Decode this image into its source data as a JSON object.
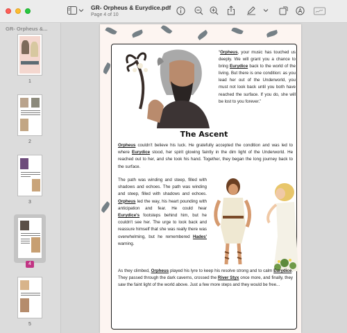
{
  "window": {
    "title": "GR- Orpheus & Eurydice.pdf",
    "subtitle": "Page 4 of 10"
  },
  "toolbar": {
    "icons": [
      "sidebar-toggle-icon",
      "chevron-down-icon",
      "info-icon",
      "zoom-out-icon",
      "zoom-in-icon",
      "share-icon",
      "markup-pen-icon",
      "chevron-down-icon",
      "rotate-icon",
      "annotate-icon",
      "sign-icon"
    ]
  },
  "sidebar": {
    "title": "GR- Orpheus &...",
    "thumbnails": [
      {
        "page": "1"
      },
      {
        "page": "2"
      },
      {
        "page": "3"
      },
      {
        "page": "4",
        "selected": true
      },
      {
        "page": "5"
      }
    ]
  },
  "page": {
    "quote": {
      "open": "“",
      "name1": "Orpheus",
      "t1": ", your music has touched us deeply. We will grant you a chance to bring ",
      "name2": "Eurydice",
      "t2": " back to the world of the living. But there is one condition: as you lead her out of the Underworld, you must not look back until you both have reached the surface. If you do, she will be lost to you forever.”"
    },
    "section_title": "The Ascent",
    "p1": {
      "name1": "Orpheus",
      "t1": " couldn't believe his luck. He gratefully accepted the condition and was led to where ",
      "name2": "Eurydice",
      "t2": " stood, her spirit glowing faintly in the dim light of the Underworld. He reached out to her, and she took his hand. Together, they began the long journey back to the surface."
    },
    "p2": {
      "t0": "The path was winding and steep, filled with shadows and echoes. The path was winding and steep, filled with shadows and echoes. ",
      "name1": "Orpheus",
      "t1": " led the way, his heart pounding with anticipation and fear. He could hear ",
      "name2": "Eurydice's",
      "t2": " footsteps behind him, but he couldn't see her. The urge to look back and reassure himself that she was really there was overwhelming, but he remembered ",
      "name3": "Hades'",
      "t3": " warning."
    },
    "p3": {
      "t0": "As they climbed, ",
      "name1": "Orpheus",
      "t1": " played his lyre to keep his resolve strong and to calm ",
      "name2": "Eurydice",
      "t2": ". They passed through the dark caverns, crossed the ",
      "name3": "River Styx",
      "t3": " once more, and finally, they saw the faint light of the world above. Just a few more steps and they would be free..."
    }
  },
  "colors": {
    "accent_selected": "#c13584",
    "page_bg": "#fdf5f1",
    "leaf": "#5d6b73"
  }
}
